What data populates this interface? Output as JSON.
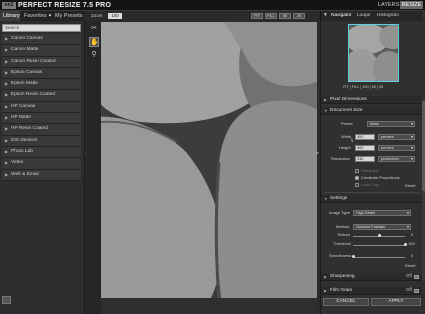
{
  "titlebar": {
    "logo_text": "on1",
    "app_title": "PERFECT RESIZE 7.5 PRO",
    "mode_layers": "LAYERS",
    "mode_resize": "RESIZE"
  },
  "left_panel": {
    "tabs": [
      {
        "label": "Library"
      },
      {
        "label": "Favorites"
      },
      {
        "label": "My Presets"
      }
    ],
    "search_placeholder": "Search",
    "preset_groups": [
      {
        "label": "Canon Canvas"
      },
      {
        "label": "Canon Matte"
      },
      {
        "label": "Canon Resin Coated"
      },
      {
        "label": "Epson Canvas"
      },
      {
        "label": "Epson Matte"
      },
      {
        "label": "Epson Resin Coated"
      },
      {
        "label": "HP Canvas"
      },
      {
        "label": "HP Matte"
      },
      {
        "label": "HP Resin Coated"
      },
      {
        "label": "iOS Devices"
      },
      {
        "label": "Photo Lab"
      },
      {
        "label": "Video"
      },
      {
        "label": "Web & Email"
      }
    ]
  },
  "zoom_bar": {
    "label": "Zoom",
    "value": "100",
    "buttons": [
      "FIT",
      "FILL",
      "50",
      "25"
    ]
  },
  "navigator": {
    "tabs": [
      "Navigator",
      "Loupe",
      "Histogram"
    ],
    "readout": "FIT | FILL | 100 | 50 | 25"
  },
  "sections": {
    "pixel_dimensions": "Pixel Dimensions",
    "document_size": "Document Size",
    "settings": "Settings",
    "sharpening": "Sharpening",
    "film_grain": "Film Grain"
  },
  "document_size": {
    "preset_label": "Preset",
    "preset_value": "None",
    "width_label": "Width",
    "width_value": "400",
    "width_unit": "percent",
    "height_label": "Height",
    "height_value": "400",
    "height_unit": "percent",
    "resolution_label": "Resolution",
    "resolution_value": "240",
    "resolution_unit": "pixels/inch",
    "resample_label": "Resample",
    "constrain_label": "Constrain Proportions",
    "crop_label": "Lock Crop",
    "constrain_checked": true,
    "reset_label": "Reset"
  },
  "settings": {
    "image_type_label": "Image Type",
    "image_type_value": "High Detail",
    "method_label": "Method",
    "method_value": "Genuine Fractals",
    "texture_label": "Texture",
    "texture_value": "0",
    "texture_level": 0.5,
    "threshold_label": "Threshold",
    "threshold_value": "100",
    "threshold_level": 1.0,
    "smoothness_label": "Smoothness",
    "smoothness_value": "0",
    "smoothness_level": 0.0,
    "reset_label": "Reset"
  },
  "sharpening": {
    "toggle_label": "Off"
  },
  "film_grain": {
    "toggle_label": "Off"
  },
  "footer": {
    "cancel_label": "CANCEL",
    "apply_label": "APPLY"
  },
  "colors": {
    "accent_nav_border": "#59d0e8",
    "panel_bg": "#303030",
    "title_bg": "#141414"
  }
}
